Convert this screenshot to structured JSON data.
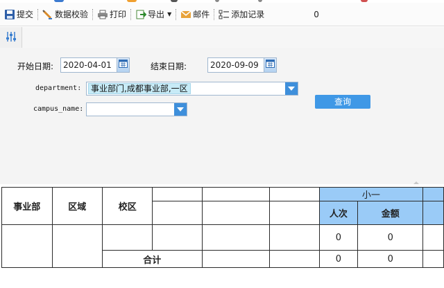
{
  "toolbar": {
    "submit": "提交",
    "validate": "数据校验",
    "print": "打印",
    "export": "导出",
    "mail": "邮件",
    "add_record": "添加记录",
    "count": "0"
  },
  "filters": {
    "start_date_label": "开始日期:",
    "start_date": "2020-04-01",
    "end_date_label": "结束日期:",
    "end_date": "2020-09-09",
    "department_label": "department:",
    "department_value": "事业部门,成都事业部,一区",
    "campus_label": "campus_name:",
    "campus_value": "",
    "query_button": "查询"
  },
  "report": {
    "col_division": "事业部",
    "col_region": "区域",
    "col_campus": "校区",
    "group_header": "小一",
    "sub_count": "人次",
    "sub_amount": "金额",
    "row1": {
      "count": "0",
      "amount": "0"
    },
    "total_label": "合计",
    "total": {
      "count": "0",
      "amount": "0"
    }
  },
  "colors": {
    "accent": "#3f98e6",
    "header_blue": "#9acbf7",
    "chip": "#c7ebf7"
  }
}
